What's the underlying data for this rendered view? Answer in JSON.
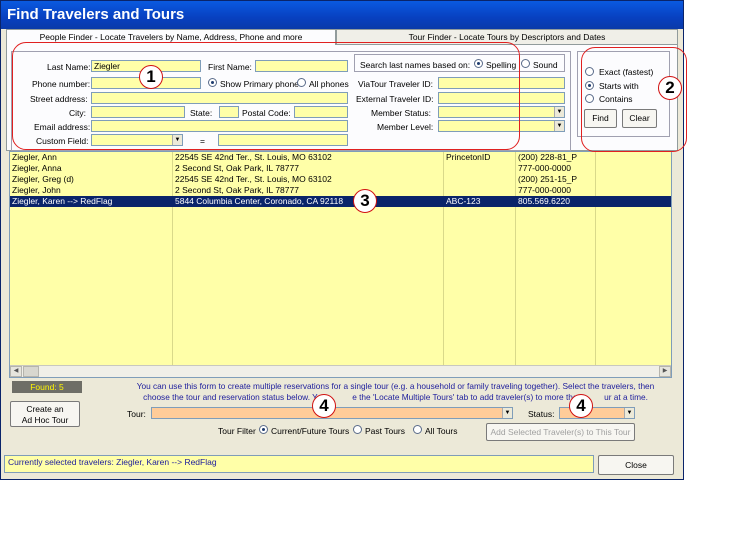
{
  "window": {
    "title": "Find Travelers and Tours"
  },
  "tabs": [
    {
      "label": "People Finder - Locate Travelers by Name, Address, Phone and more"
    },
    {
      "label": "Tour Finder - Locate Tours by Descriptors and Dates"
    }
  ],
  "search": {
    "last_name_label": "Last Name:",
    "last_name_value": "Ziegler",
    "first_name_label": "First Name:",
    "first_name_value": "",
    "phone_label": "Phone number:",
    "show_primary_label": "Show Primary phone",
    "all_phones_label": "All phones",
    "street_label": "Street address:",
    "city_label": "City:",
    "state_label": "State:",
    "postal_label": "Postal Code:",
    "email_label": "Email address:",
    "custom_label": "Custom Field:",
    "equals_label": "=",
    "basis_label": "Search last names based on:",
    "spelling_label": "Spelling",
    "sound_label": "Sound",
    "viatour_id_label": "ViaTour Traveler ID:",
    "external_id_label": "External Traveler ID:",
    "member_status_label": "Member Status:",
    "member_level_label": "Member Level:"
  },
  "match": {
    "exact_label": "Exact (fastest)",
    "starts_label": "Starts with",
    "contains_label": "Contains",
    "find_label": "Find",
    "clear_label": "Clear"
  },
  "results": [
    {
      "name": "Ziegler, Ann",
      "address": "22545 SE 42nd Ter., St. Louis, MO 63102",
      "id": "PrincetonID",
      "phone": "(200) 228-81_P"
    },
    {
      "name": "Ziegler, Anna",
      "address": "2 Second St, Oak Park, IL 78777",
      "id": "",
      "phone": "777-000-0000"
    },
    {
      "name": "Ziegler, Greg (d)",
      "address": "22545 SE 42nd Ter., St. Louis, MO 63102",
      "id": "",
      "phone": "(200) 251-15_P"
    },
    {
      "name": "Ziegler, John",
      "address": "2 Second St, Oak Park, IL 78777",
      "id": "",
      "phone": "777-000-0000"
    },
    {
      "name": "Ziegler, Karen        --> RedFlag",
      "address": "5844 Columbia Center, Coronado, CA 92118",
      "id": "ABC-123",
      "phone": "805.569.6220"
    }
  ],
  "footer": {
    "found_label": "Found: 5",
    "info_line1": "You can use this form to create multiple reservations for a single tour (e.g. a household or family traveling together).  Select the travelers, then",
    "info_line2_a": "choose the tour and reservation status below.  You",
    "info_line2_b": "e the 'Locate Multiple Tours' tab to add traveler(s) to more than",
    "info_line2_c": "ur at a time.",
    "adhoc_line1": "Create an",
    "adhoc_line2": "Ad Hoc Tour",
    "tour_label": "Tour:",
    "status_label": "Status:",
    "tour_filter_label": "Tour Filter",
    "current_future_label": "Current/Future Tours",
    "past_label": "Past Tours",
    "all_tours_label": "All Tours",
    "add_selected_label": "Add Selected Traveler(s) to This Tour",
    "selected_status": "Currently selected travelers: Ziegler, Karen        --> RedFlag",
    "close_label": "Close"
  },
  "callouts": [
    "1",
    "2",
    "3",
    "4",
    "4"
  ],
  "colors": {
    "input_bg": "#ffffa8",
    "selection": "#0a246a",
    "callout": "#e02020",
    "title_bar": "#0a4fd8"
  }
}
